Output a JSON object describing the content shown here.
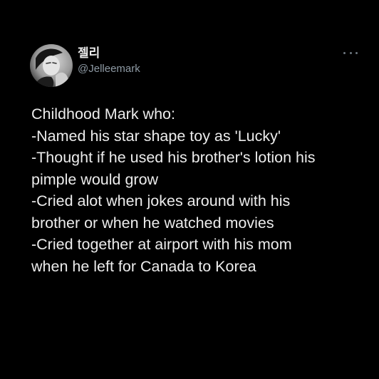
{
  "tweet": {
    "author": {
      "display_name": "젤리",
      "handle": "@Jelleemark"
    },
    "menu_icon": "more-horizontal-icon",
    "lines": [
      "Childhood Mark who:",
      "-Named his star shape toy as 'Lucky'",
      "-Thought if he used his brother's lotion his",
      "pimple would grow",
      "-Cried alot when jokes around with his",
      "brother or when he watched movies",
      "-Cried together at airport with his mom",
      "when he left for Canada to Korea"
    ]
  },
  "colors": {
    "background": "#000000",
    "text": "#ececec",
    "handle": "#8e9aa4",
    "menu_dots": "#6e7780"
  }
}
